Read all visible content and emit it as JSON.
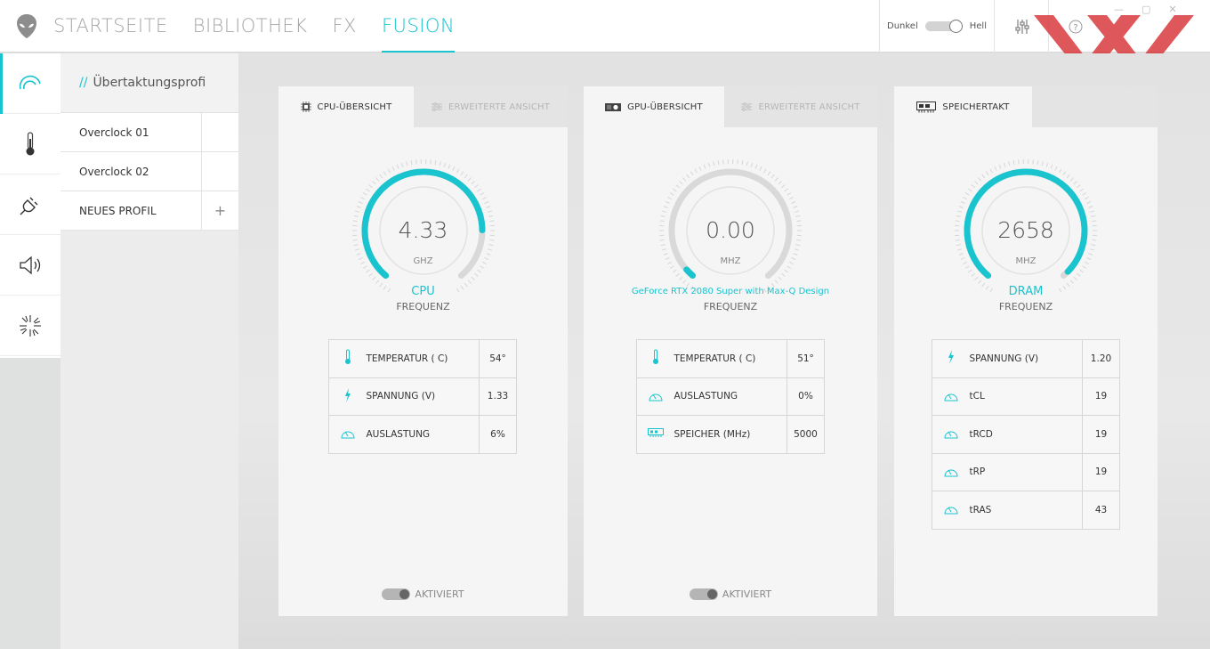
{
  "nav": {
    "items": [
      {
        "label": "STARTSEITE"
      },
      {
        "label": "BIBLIOTHEK"
      },
      {
        "label": "FX"
      },
      {
        "label": "FUSION"
      }
    ],
    "active_index": 3
  },
  "theme": {
    "dark_label": "Dunkel",
    "light_label": "Hell"
  },
  "rail": {
    "icons": [
      "overclock-gauge-icon",
      "thermometer-icon",
      "power-plug-icon",
      "speaker-icon",
      "light-burst-icon"
    ]
  },
  "profiles": {
    "header_prefix": "//",
    "header": "Übertaktungsprofi",
    "items": [
      {
        "label": "Overclock 01"
      },
      {
        "label": "Overclock 02"
      },
      {
        "label": "NEUES PROFIL",
        "action": "+"
      }
    ]
  },
  "cpu": {
    "tab_active": "CPU-ÜBERSICHT",
    "tab_inactive": "ERWEITERTE ANSICHT",
    "value": "4.33",
    "unit": "GHZ",
    "name": "CPU",
    "sub": "FREQUENZ",
    "fill": 0.82,
    "rows": [
      {
        "icon": "thermometer-icon",
        "label": "TEMPERATUR ( C)",
        "value": "54°"
      },
      {
        "icon": "bolt-icon",
        "label": "SPANNUNG (V)",
        "value": "1.33"
      },
      {
        "icon": "gauge-icon",
        "label": "AUSLASTUNG",
        "value": "6%"
      }
    ],
    "activated": "AKTIVIERT"
  },
  "gpu": {
    "tab_active": "GPU-ÜBERSICHT",
    "tab_inactive": "ERWEITERTE ANSICHT",
    "value": "0.00",
    "unit": "MHZ",
    "name": "GeForce RTX 2080 Super with Max-Q Design",
    "sub": "FREQUENZ",
    "fill": 0.03,
    "rows": [
      {
        "icon": "thermometer-icon",
        "label": "TEMPERATUR ( C)",
        "value": "51°"
      },
      {
        "icon": "gauge-icon",
        "label": "AUSLASTUNG",
        "value": "0%"
      },
      {
        "icon": "memory-icon",
        "label": "SPEICHER (MHz)",
        "value": "5000"
      }
    ],
    "activated": "AKTIVIERT"
  },
  "mem": {
    "tab_active": "SPEICHERTAKT",
    "value": "2658",
    "unit": "MHZ",
    "name": "DRAM",
    "sub": "FREQUENZ",
    "fill": 0.98,
    "rows": [
      {
        "icon": "bolt-icon",
        "label": "SPANNUNG (V)",
        "value": "1.20"
      },
      {
        "icon": "gauge-icon",
        "label": "tCL",
        "value": "19"
      },
      {
        "icon": "gauge-icon",
        "label": "tRCD",
        "value": "19"
      },
      {
        "icon": "gauge-icon",
        "label": "tRP",
        "value": "19"
      },
      {
        "icon": "gauge-icon",
        "label": "tRAS",
        "value": "43"
      }
    ]
  },
  "colors": {
    "accent": "#19c4cf",
    "track": "#d9d9d9",
    "watermark": "#d93a3f"
  }
}
